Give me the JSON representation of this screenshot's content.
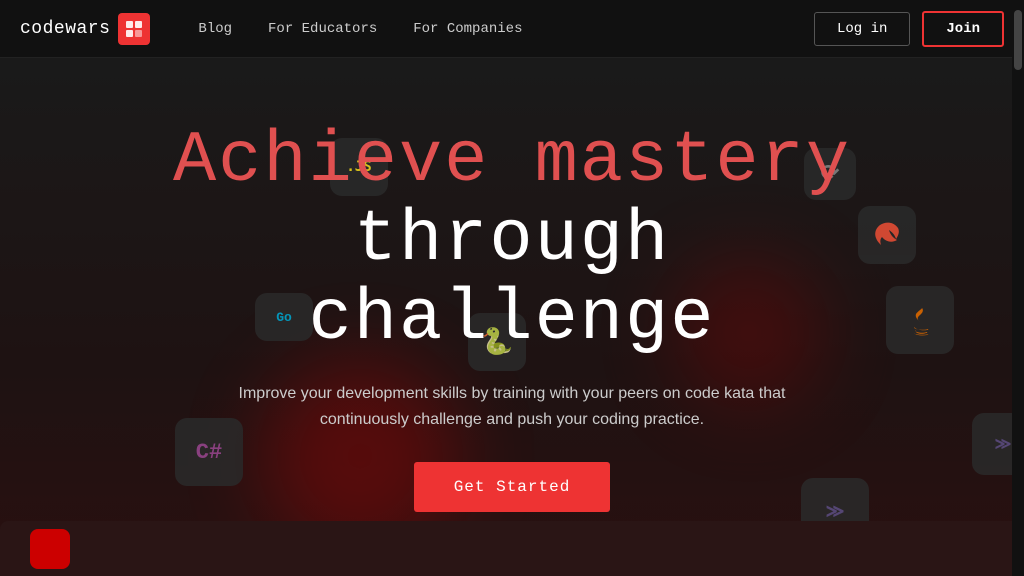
{
  "brand": {
    "name": "codewars",
    "logo_icon": "✦"
  },
  "nav": {
    "links": [
      {
        "label": "Blog",
        "id": "blog"
      },
      {
        "label": "For Educators",
        "id": "educators"
      },
      {
        "label": "For Companies",
        "id": "companies"
      }
    ],
    "login_label": "Log in",
    "join_label": "Join"
  },
  "hero": {
    "title_line1": "Achieve mastery",
    "title_line2": "through challenge",
    "subtitle": "Improve your development skills by training with your peers on code kata that continuously challenge and push your coding practice.",
    "cta_label": "Get Started"
  },
  "lang_icons": [
    {
      "id": "js",
      "symbol": "JS",
      "label": "javascript-icon"
    },
    {
      "id": "go",
      "symbol": "Go",
      "label": "go-icon"
    },
    {
      "id": "python",
      "symbol": "🐍",
      "label": "python-icon"
    },
    {
      "id": "csharp",
      "symbol": "C#",
      "label": "csharp-icon"
    },
    {
      "id": "swift",
      "symbol": "◆",
      "label": "swift-icon"
    },
    {
      "id": "java",
      "symbol": "☕",
      "label": "java-icon"
    },
    {
      "id": "haskell",
      "symbol": "≫",
      "label": "haskell-icon"
    }
  ]
}
